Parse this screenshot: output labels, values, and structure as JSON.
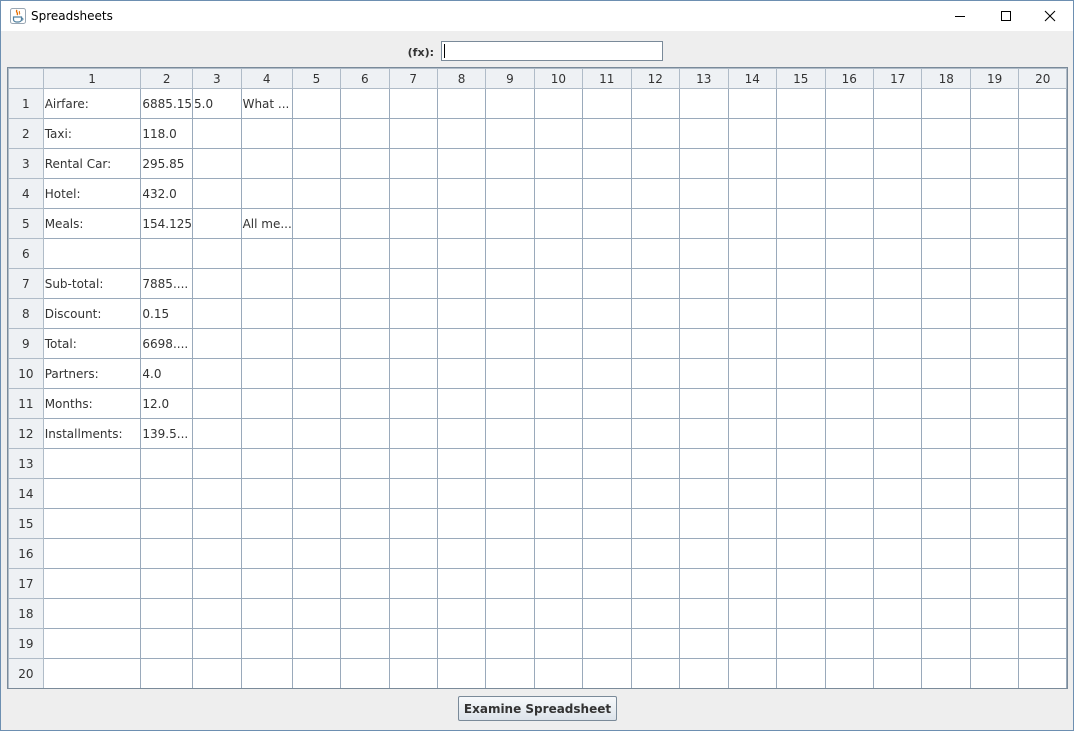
{
  "window": {
    "title": "Spreadsheets",
    "app_icon": "java-cup-icon",
    "controls": {
      "minimize": "minimize-icon",
      "maximize": "maximize-icon",
      "close": "close-icon"
    }
  },
  "formula_bar": {
    "label": "(fx):",
    "value": ""
  },
  "grid": {
    "columns": [
      "1",
      "2",
      "3",
      "4",
      "5",
      "6",
      "7",
      "8",
      "9",
      "10",
      "11",
      "12",
      "13",
      "14",
      "15",
      "16",
      "17",
      "18",
      "19",
      "20"
    ],
    "rows": [
      {
        "header": "1",
        "cells": [
          "Airfare:",
          "6885.15",
          "5.0",
          "What ..."
        ]
      },
      {
        "header": "2",
        "cells": [
          "Taxi:",
          "118.0"
        ]
      },
      {
        "header": "3",
        "cells": [
          "Rental Car:",
          "295.85"
        ]
      },
      {
        "header": "4",
        "cells": [
          "Hotel:",
          "432.0"
        ]
      },
      {
        "header": "5",
        "cells": [
          "Meals:",
          "154.125",
          "",
          "All me..."
        ]
      },
      {
        "header": "6",
        "cells": []
      },
      {
        "header": "7",
        "cells": [
          "Sub-total:",
          "7885...."
        ]
      },
      {
        "header": "8",
        "cells": [
          "Discount:",
          "0.15"
        ]
      },
      {
        "header": "9",
        "cells": [
          "Total:",
          "6698...."
        ]
      },
      {
        "header": "10",
        "cells": [
          "Partners:",
          "4.0"
        ]
      },
      {
        "header": "11",
        "cells": [
          "Months:",
          "12.0"
        ]
      },
      {
        "header": "12",
        "cells": [
          "Installments:",
          "139.5..."
        ]
      },
      {
        "header": "13",
        "cells": []
      },
      {
        "header": "14",
        "cells": []
      },
      {
        "header": "15",
        "cells": []
      },
      {
        "header": "16",
        "cells": []
      },
      {
        "header": "17",
        "cells": []
      },
      {
        "header": "18",
        "cells": []
      },
      {
        "header": "19",
        "cells": []
      },
      {
        "header": "20",
        "cells": []
      }
    ]
  },
  "actions": {
    "examine_label": "Examine Spreadsheet"
  }
}
